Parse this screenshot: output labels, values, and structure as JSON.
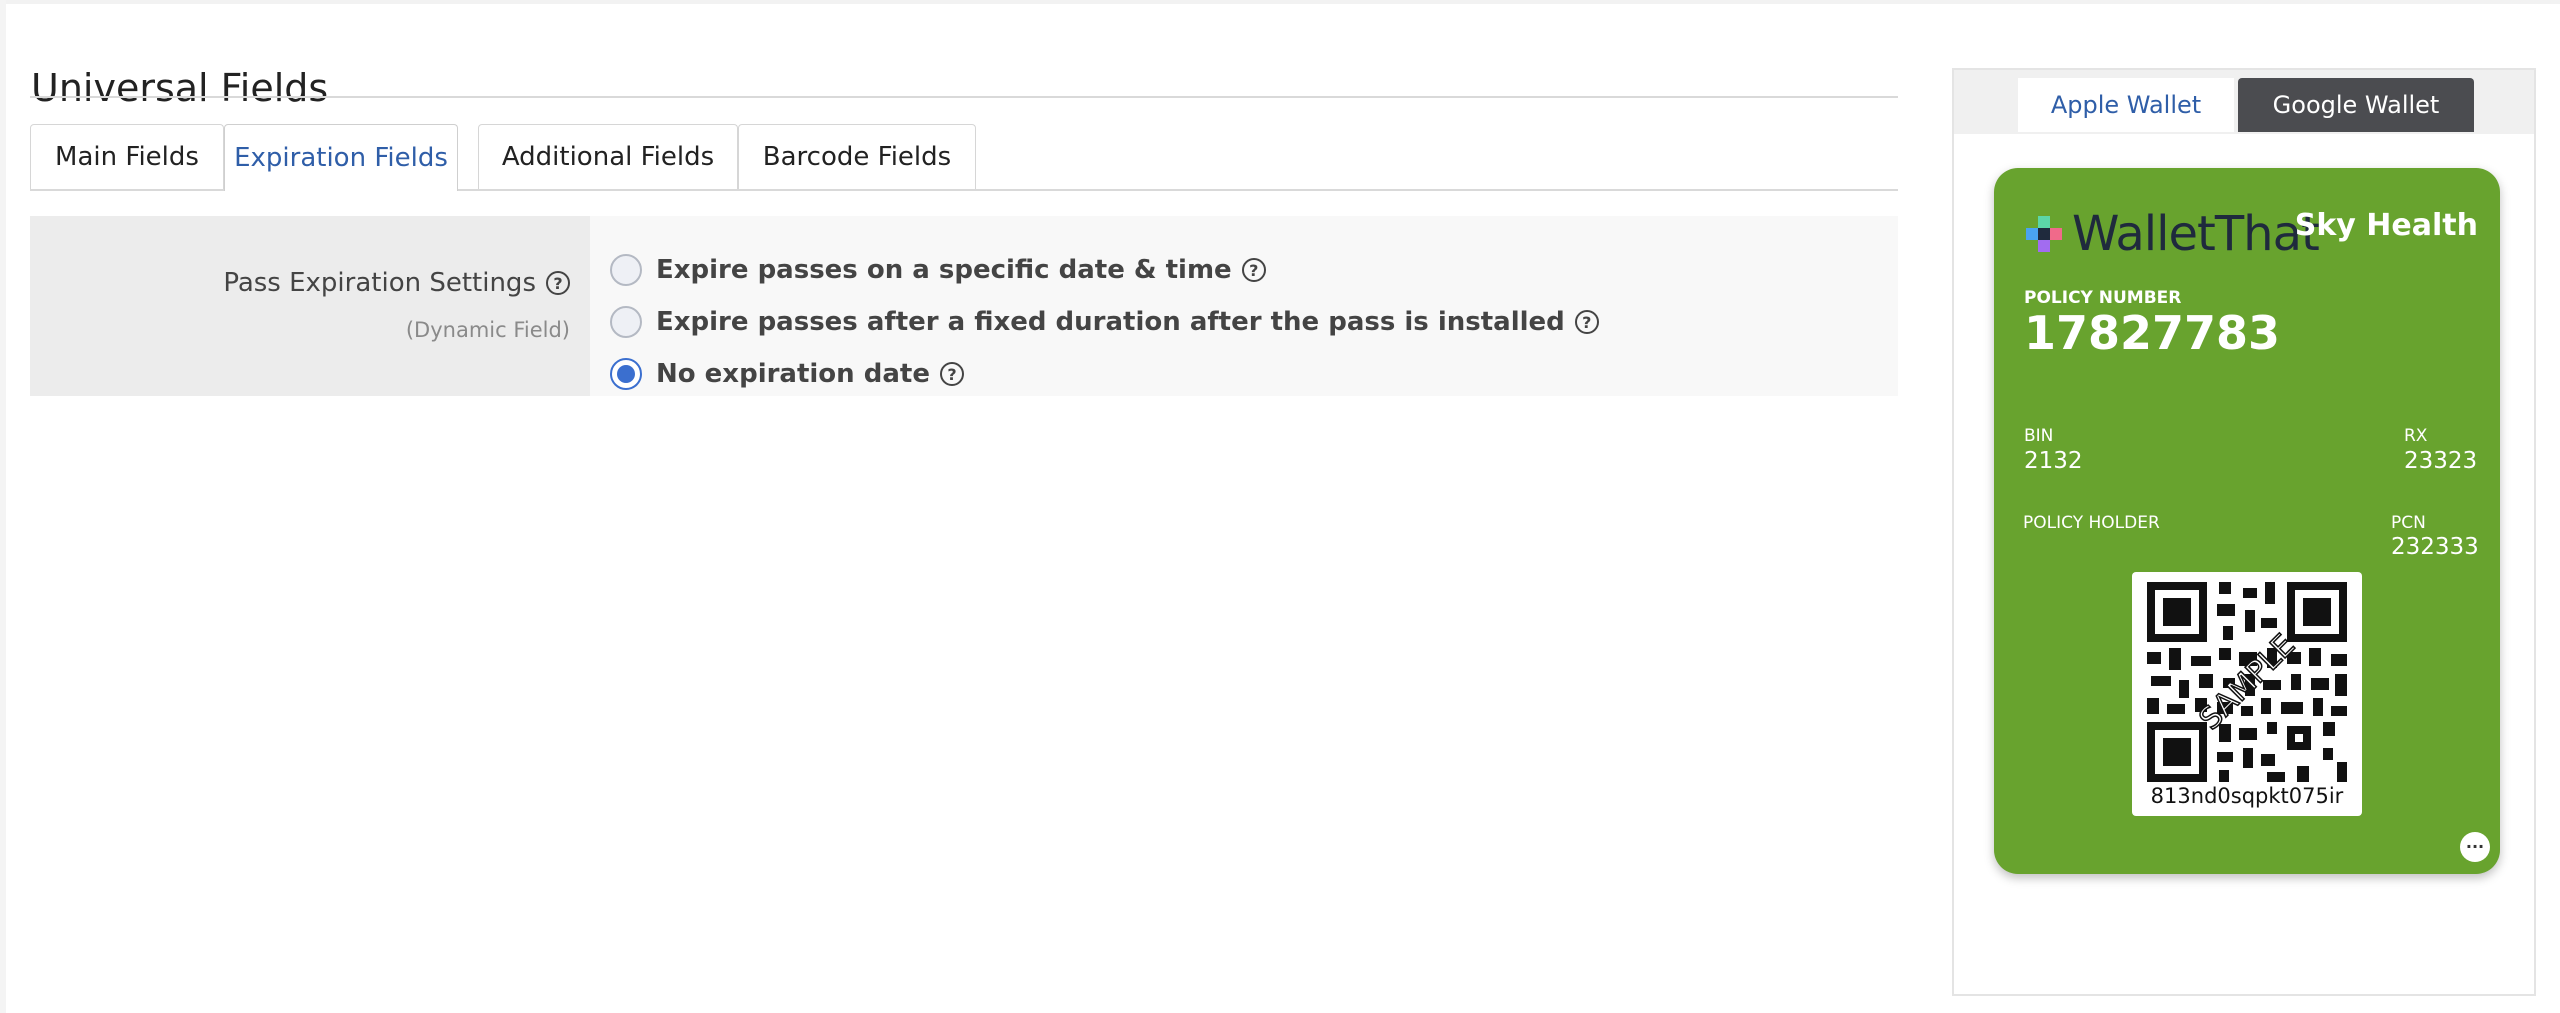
{
  "section": {
    "title": "Universal Fields"
  },
  "tabs": [
    {
      "label": "Main Fields",
      "active": false
    },
    {
      "label": "Expiration Fields",
      "active": true
    },
    {
      "label": "Additional Fields",
      "active": false
    },
    {
      "label": "Barcode Fields",
      "active": false
    }
  ],
  "expiration": {
    "label": "Pass Expiration Settings",
    "sublabel": "(Dynamic Field)",
    "help_icon": "question-circle-icon",
    "options": [
      {
        "label": "Expire passes on a specific date & time",
        "checked": false
      },
      {
        "label": "Expire passes after a fixed duration after the pass is installed",
        "checked": false
      },
      {
        "label": "No expiration date",
        "checked": true
      }
    ]
  },
  "preview": {
    "tabs": [
      {
        "label": "Apple Wallet",
        "active": true
      },
      {
        "label": "Google Wallet",
        "active": false
      }
    ],
    "card": {
      "color": "#68a32e",
      "logo_text": "WalletThat",
      "brand": "Sky Health",
      "policy_number_label": "POLICY NUMBER",
      "policy_number": "17827783",
      "bin_label": "BIN",
      "bin": "2132",
      "rx_label": "RX",
      "rx": "23323",
      "holder_label": "POLICY HOLDER",
      "pcn_label": "PCN",
      "pcn": "232333",
      "barcode_watermark": "SAMPLE",
      "barcode_text": "813nd0sqpkt075ir",
      "more_icon": "more-dots-icon",
      "more_label": "···"
    }
  }
}
